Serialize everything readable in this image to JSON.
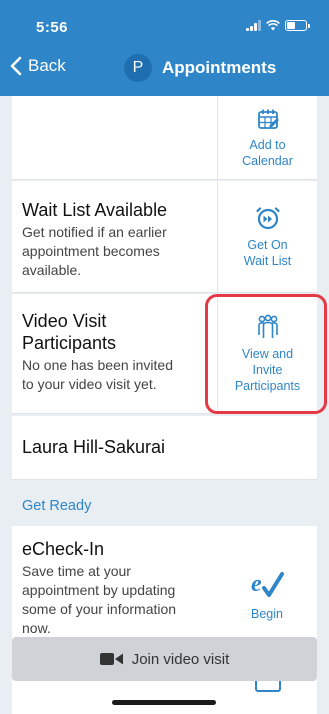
{
  "status_bar": {
    "time": "5:56"
  },
  "nav": {
    "back_label": "Back",
    "avatar_letter": "P",
    "title": "Appointments"
  },
  "cards": {
    "calendar": {
      "action": [
        "Add to",
        "Calendar"
      ]
    },
    "waitlist": {
      "title": "Wait List Available",
      "desc": [
        "Get notified if an earlier",
        "appointment becomes",
        "available."
      ],
      "action": [
        "Get On",
        "Wait List"
      ]
    },
    "video": {
      "title": [
        "Video Visit",
        "Participants"
      ],
      "desc": [
        "No one has been invited",
        "to your video visit yet."
      ],
      "action": [
        "View and",
        "Invite",
        "Participants"
      ]
    },
    "provider": {
      "name": "Laura Hill-Sakurai"
    },
    "echeckin": {
      "title": "eCheck-In",
      "desc": [
        "Save time at your",
        "appointment by updating",
        "some of your information",
        "now."
      ],
      "action": "Begin"
    }
  },
  "section": {
    "get_ready": "Get Ready"
  },
  "join": {
    "label": "Join video visit"
  },
  "colors": {
    "brand": "#2e86c8",
    "highlight": "#e43a45"
  }
}
